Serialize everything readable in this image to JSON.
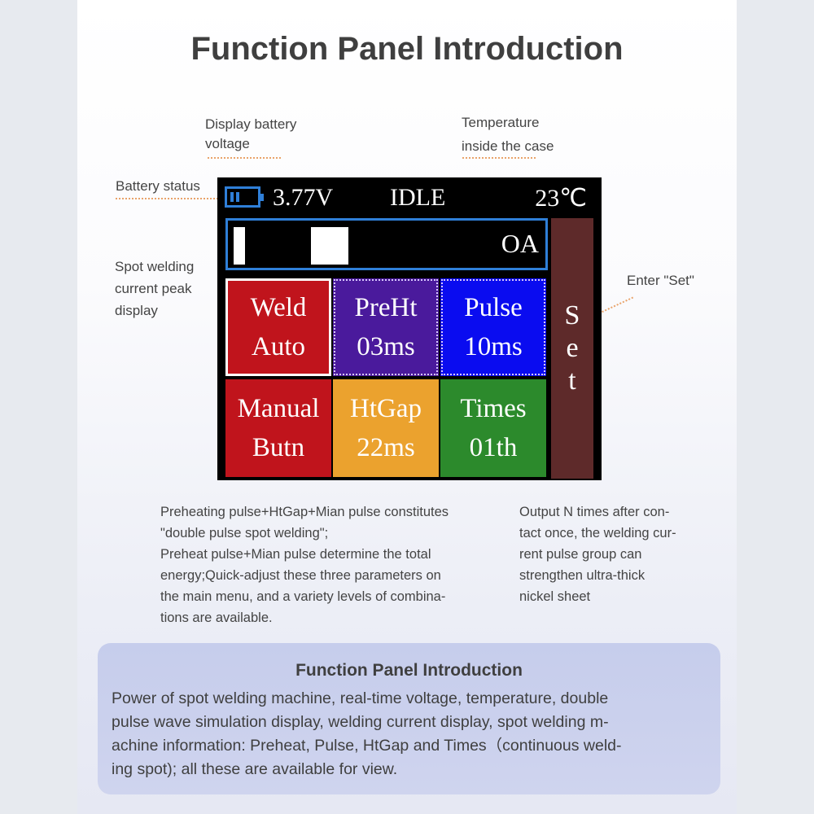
{
  "title": "Function Panel Introduction",
  "callouts": {
    "battery_voltage": [
      "Display battery",
      "voltage"
    ],
    "temperature": [
      "Temperature",
      "inside the case"
    ],
    "battery_status": "Battery status",
    "current_peak": [
      "Spot welding",
      "current peak",
      "display"
    ],
    "enter_set": "Enter \"Set\""
  },
  "screen": {
    "voltage": "3.77V",
    "status": "IDLE",
    "temperature": "23℃",
    "current": "OA",
    "cells": [
      {
        "line1": "Weld",
        "line2": "Auto",
        "color": "#c0141c"
      },
      {
        "line1": "PreHt",
        "line2": "03ms",
        "color": "#4a1a9c"
      },
      {
        "line1": "Pulse",
        "line2": "10ms",
        "color": "#0a0cf0"
      },
      {
        "line1": "Manual",
        "line2": "Butn",
        "color": "#c0141c"
      },
      {
        "line1": "HtGap",
        "line2": "22ms",
        "color": "#eba22e"
      },
      {
        "line1": "Times",
        "line2": "01th",
        "color": "#2c8a2c"
      }
    ],
    "set_letters": [
      "S",
      "e",
      "t"
    ],
    "set_color": "#5e2a2a"
  },
  "descriptions": {
    "left": [
      "Preheating pulse+HtGap+Mian pulse constitutes",
      "\"double pulse spot welding\";",
      "Preheat pulse+Mian pulse determine the total",
      "energy;Quick-adjust these three parameters on",
      "the main menu, and a variety levels of combina-",
      "tions are available."
    ],
    "right": [
      "Output N times after con-",
      "tact once, the welding cur-",
      "rent pulse group can",
      "strengthen ultra-thick",
      "nickel sheet"
    ]
  },
  "info_box": {
    "heading": "Function Panel Introduction",
    "lines": [
      "Power of spot welding machine, real-time voltage, temperature, double",
      "pulse wave simulation display, welding current display, spot welding m-",
      "achine information: Preheat, Pulse, HtGap and Times（continuous weld-",
      "ing spot); all these are available for view."
    ]
  }
}
